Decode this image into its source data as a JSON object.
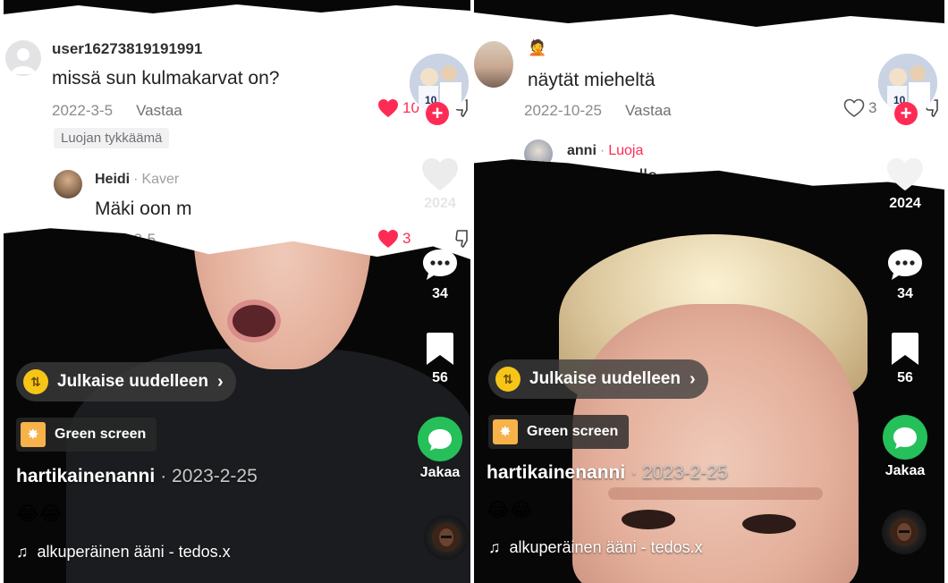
{
  "left": {
    "comment": {
      "username": "user16273819191991",
      "text": "missä sun kulmakarvat on?",
      "date": "2022-3-5",
      "reply_label": "Vastaa",
      "badge": "Luojan tykkäämä",
      "likes": "10"
    },
    "reply": {
      "author": "Heidi",
      "tag": "Kaver",
      "text": "Mäki oon m",
      "date": "2022-3-5",
      "likes": "3"
    },
    "rail": {
      "likes": "2024",
      "comments": "34",
      "saves": "56",
      "share_label": "Jakaa"
    },
    "repost_label": "Julkaise uudelleen",
    "green_screen_label": "Green screen",
    "author": "hartikainenanni",
    "post_date": "· 2023-2-25",
    "emoji": "😂😂",
    "sound": "alkuperäinen ääni - tedos.x"
  },
  "right": {
    "comment": {
      "username": "🤦",
      "text": "näytät mieheltä",
      "date": "2022-10-25",
      "reply_label": "Vastaa",
      "likes": "3"
    },
    "reply": {
      "author": "anni",
      "tag": "Luoja",
      "text": "t aluun olla"
    },
    "rail": {
      "likes": "2024",
      "comments": "34",
      "saves": "56",
      "share_label": "Jakaa"
    },
    "repost_label": "Julkaise uudelleen",
    "green_screen_label": "Green screen",
    "author": "hartikainenanni",
    "post_date": "· 2023-2-25",
    "emoji": "😂😂",
    "sound": "alkuperäinen ääni - tedos.x"
  },
  "colors": {
    "like_red": "#fe2c55",
    "share_green": "#25c05a",
    "repost_yellow": "#f5c518"
  }
}
